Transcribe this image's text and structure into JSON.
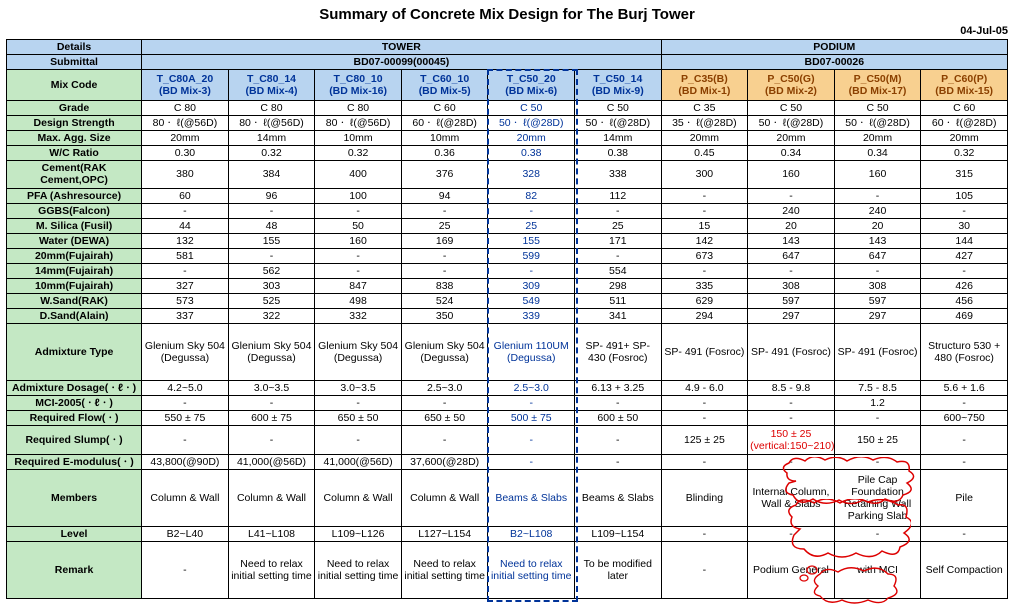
{
  "title": "Summary of Concrete Mix Design for The Burj Tower",
  "date": "04-Jul-05",
  "header": {
    "details": "Details",
    "tower": "TOWER",
    "podium": "PODIUM",
    "submittal": "Submittal",
    "sub_tower": "BD07-00099(00045)",
    "sub_podium": "BD07-00026",
    "mixcode": "Mix Code"
  },
  "mix": [
    {
      "a": "T_C80A_20",
      "b": "(BD Mix-3)"
    },
    {
      "a": "T_C80_14",
      "b": "(BD Mix-4)"
    },
    {
      "a": "T_C80_10",
      "b": "(BD Mix-16)"
    },
    {
      "a": "T_C60_10",
      "b": "(BD Mix-5)"
    },
    {
      "a": "T_C50_20",
      "b": "(BD Mix-6)"
    },
    {
      "a": "T_C50_14",
      "b": "(BD Mix-9)"
    },
    {
      "a": "P_C35(B)",
      "b": "(BD Mix-1)"
    },
    {
      "a": "P_C50(G)",
      "b": "(BD Mix-2)"
    },
    {
      "a": "P_C50(M)",
      "b": "(BD Mix-17)"
    },
    {
      "a": "P_C60(P)",
      "b": "(BD Mix-15)"
    }
  ],
  "rows": [
    {
      "label": "Grade",
      "v": [
        "C 80",
        "C 80",
        "C 80",
        "C 60",
        "C 50",
        "C 50",
        "C 35",
        "C 50",
        "C 50",
        "C 60"
      ]
    },
    {
      "label": "Design Strength",
      "v": [
        "80ㆍ ℓ(@56D)",
        "80ㆍ ℓ(@56D)",
        "80ㆍ ℓ(@56D)",
        "60ㆍ ℓ(@28D)",
        "50ㆍ ℓ(@28D)",
        "50ㆍ ℓ(@28D)",
        "35ㆍ ℓ(@28D)",
        "50ㆍ ℓ(@28D)",
        "50ㆍ ℓ(@28D)",
        "60ㆍ ℓ(@28D)"
      ]
    },
    {
      "label": "Max. Agg. Size",
      "v": [
        "20mm",
        "14mm",
        "10mm",
        "10mm",
        "20mm",
        "14mm",
        "20mm",
        "20mm",
        "20mm",
        "20mm"
      ]
    },
    {
      "label": "W/C Ratio",
      "v": [
        "0.30",
        "0.32",
        "0.32",
        "0.36",
        "0.38",
        "0.38",
        "0.45",
        "0.34",
        "0.34",
        "0.32"
      ]
    },
    {
      "label": "Cement(RAK Cement,OPC)",
      "v": [
        "380",
        "384",
        "400",
        "376",
        "328",
        "338",
        "300",
        "160",
        "160",
        "315"
      ]
    },
    {
      "label": "PFA (Ashresource)",
      "v": [
        "60",
        "96",
        "100",
        "94",
        "82",
        "112",
        "-",
        "-",
        "-",
        "105"
      ]
    },
    {
      "label": "GGBS(Falcon)",
      "v": [
        "-",
        "-",
        "-",
        "-",
        "-",
        "-",
        "-",
        "240",
        "240",
        "-"
      ]
    },
    {
      "label": "M. Silica (Fusil)",
      "v": [
        "44",
        "48",
        "50",
        "25",
        "25",
        "25",
        "15",
        "20",
        "20",
        "30"
      ]
    },
    {
      "label": "Water (DEWA)",
      "v": [
        "132",
        "155",
        "160",
        "169",
        "155",
        "171",
        "142",
        "143",
        "143",
        "144"
      ]
    },
    {
      "label": "20mm(Fujairah)",
      "v": [
        "581",
        "-",
        "-",
        "-",
        "599",
        "-",
        "673",
        "647",
        "647",
        "427"
      ]
    },
    {
      "label": "14mm(Fujairah)",
      "v": [
        "-",
        "562",
        "-",
        "-",
        "-",
        "554",
        "-",
        "-",
        "-",
        "-"
      ]
    },
    {
      "label": "10mm(Fujairah)",
      "v": [
        "327",
        "303",
        "847",
        "838",
        "309",
        "298",
        "335",
        "308",
        "308",
        "426"
      ]
    },
    {
      "label": "W.Sand(RAK)",
      "v": [
        "573",
        "525",
        "498",
        "524",
        "549",
        "511",
        "629",
        "597",
        "597",
        "456"
      ]
    },
    {
      "label": "D.Sand(Alain)",
      "v": [
        "337",
        "322",
        "332",
        "350",
        "339",
        "341",
        "294",
        "297",
        "297",
        "469"
      ]
    },
    {
      "label": "Admixture Type",
      "v": [
        "Glenium Sky 504 (Degussa)",
        "Glenium Sky 504 (Degussa)",
        "Glenium Sky 504 (Degussa)",
        "Glenium Sky 504 (Degussa)",
        "Glenium 110UM (Degussa)",
        "SP- 491+ SP- 430 (Fosroc)",
        "SP- 491 (Fosroc)",
        "SP- 491 (Fosroc)",
        "SP- 491 (Fosroc)",
        "Structuro 530 + 480 (Fosroc)"
      ],
      "big": true
    },
    {
      "label": "Admixture Dosage(ㆍℓㆍ)",
      "v": [
        "4.2~5.0",
        "3.0~3.5",
        "3.0~3.5",
        "2.5~3.0",
        "2.5~3.0",
        "6.13 + 3.25",
        "4.9 - 6.0",
        "8.5 - 9.8",
        "7.5 - 8.5",
        "5.6 + 1.6"
      ]
    },
    {
      "label": "MCI-2005(ㆍℓㆍ)",
      "v": [
        "-",
        "-",
        "-",
        "-",
        "-",
        "-",
        "-",
        "-",
        "1.2",
        "-"
      ]
    },
    {
      "label": "Required Flow(ㆍ)",
      "v": [
        "550 ± 75",
        "600 ± 75",
        "650 ± 50",
        "650 ± 50",
        "500 ± 75",
        "600 ± 50",
        "-",
        "-",
        "-",
        "600~750"
      ]
    },
    {
      "label": "Required Slump(ㆍ)",
      "v": [
        "-",
        "-",
        "-",
        "-",
        "-",
        "-",
        "125 ± 25",
        "150 ± 25 (vertical:150~210)",
        "150 ± 25",
        "-"
      ],
      "med": true
    },
    {
      "label": "Required E-modulus(ㆍ)",
      "v": [
        "43,800(@90D)",
        "41,000(@56D)",
        "41,000(@56D)",
        "37,600(@28D)",
        "-",
        "-",
        "-",
        "-",
        "-",
        "-"
      ]
    },
    {
      "label": "Members",
      "v": [
        "Column & Wall",
        "Column & Wall",
        "Column & Wall",
        "Column & Wall",
        "Beams & Slabs",
        "Beams & Slabs",
        "Blinding",
        "Internal Column, Wall & Slabs",
        "Pile Cap Foundation Retaining Wall Parking Slab",
        "Pile"
      ],
      "big": true
    },
    {
      "label": "Level",
      "v": [
        "B2~L40",
        "L41~L108",
        "L109~L126",
        "L127~L154",
        "B2~L108",
        "L109~L154",
        "-",
        "-",
        "-",
        "-"
      ]
    },
    {
      "label": "Remark",
      "v": [
        "-",
        "Need to relax initial setting time",
        "Need to relax initial setting time",
        "Need to relax initial setting time",
        "Need to relax initial setting time",
        "To be modified later",
        "-",
        "Podium General",
        "with MCI",
        "Self Compaction"
      ],
      "big": true
    }
  ]
}
